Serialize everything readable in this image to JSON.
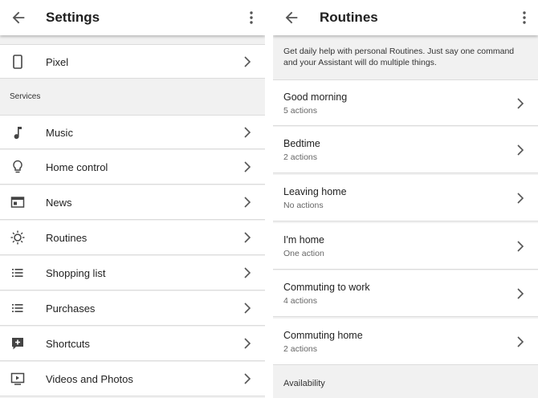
{
  "left": {
    "title": "Settings",
    "device": {
      "label": "Pixel",
      "icon": "phone-icon"
    },
    "section_label": "Services",
    "items": [
      {
        "label": "Music",
        "icon": "music-note-icon"
      },
      {
        "label": "Home control",
        "icon": "lightbulb-icon"
      },
      {
        "label": "News",
        "icon": "news-icon"
      },
      {
        "label": "Routines",
        "icon": "routines-sun-icon"
      },
      {
        "label": "Shopping list",
        "icon": "list-icon"
      },
      {
        "label": "Purchases",
        "icon": "list-icon"
      },
      {
        "label": "Shortcuts",
        "icon": "shortcut-icon"
      },
      {
        "label": "Videos and Photos",
        "icon": "video-icon"
      }
    ]
  },
  "right": {
    "title": "Routines",
    "description": "Get daily help with personal Routines. Just say one command and your Assistant will do multiple things.",
    "routines": [
      {
        "name": "Good morning",
        "actions": "5 actions"
      },
      {
        "name": "Bedtime",
        "actions": "2 actions"
      },
      {
        "name": "Leaving home",
        "actions": "No actions"
      },
      {
        "name": "I'm home",
        "actions": "One action"
      },
      {
        "name": "Commuting to work",
        "actions": "4 actions"
      },
      {
        "name": "Commuting home",
        "actions": "2 actions"
      }
    ],
    "section_label": "Availability"
  }
}
